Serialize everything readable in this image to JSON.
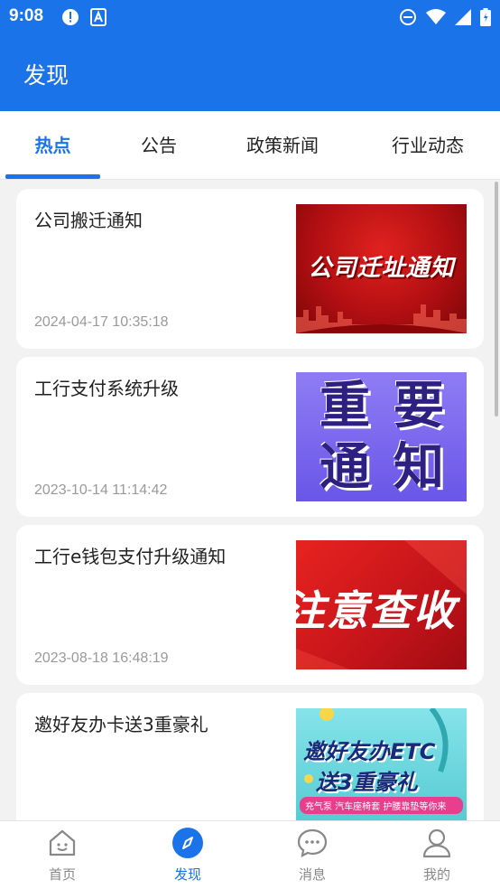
{
  "status_bar": {
    "time": "9:08"
  },
  "header": {
    "title": "发现"
  },
  "tabs": [
    {
      "label": "热点",
      "active": true
    },
    {
      "label": "公告",
      "active": false
    },
    {
      "label": "政策新闻",
      "active": false
    },
    {
      "label": "行业动态",
      "active": false
    }
  ],
  "articles": [
    {
      "title": "公司搬迁通知",
      "time": "2024-04-17 10:35:18",
      "thumbnail_text": "公司迁址通知"
    },
    {
      "title": "工行支付系统升级",
      "time": "2023-10-14 11:14:42",
      "thumbnail_text": [
        "重",
        "要",
        "通",
        "知"
      ]
    },
    {
      "title": "工行e钱包支付升级通知",
      "time": "2023-08-18 16:48:19",
      "thumbnail_text": "注意查收"
    },
    {
      "title": "邀好友办卡送3重豪礼",
      "time": "",
      "thumbnail_text": [
        "邀好友办ETC",
        "送3重豪礼",
        "充气泵 汽车座椅套 护腰靠垫等你来"
      ]
    }
  ],
  "bottom_nav": [
    {
      "label": "首页",
      "icon": "home-icon",
      "active": false
    },
    {
      "label": "发现",
      "icon": "compass-icon",
      "active": true
    },
    {
      "label": "消息",
      "icon": "message-icon",
      "active": false
    },
    {
      "label": "我的",
      "icon": "user-icon",
      "active": false
    }
  ],
  "colors": {
    "primary": "#1a73e8",
    "background": "#f2f2f2",
    "inactive": "#888888"
  }
}
